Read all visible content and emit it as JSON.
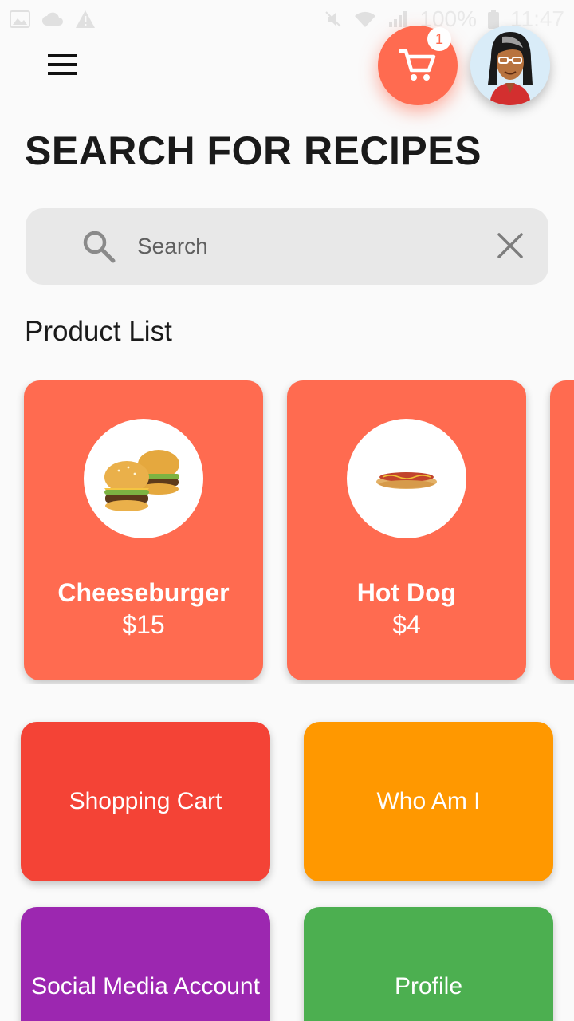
{
  "status_bar": {
    "battery": "100%",
    "time": "11:47"
  },
  "header": {
    "cart_count": "1"
  },
  "page_title": "SEARCH FOR RECIPES",
  "search": {
    "placeholder": "Search",
    "value": ""
  },
  "section_title": "Product List",
  "products": [
    {
      "name": "Cheeseburger",
      "price": "$15"
    },
    {
      "name": "Hot Dog",
      "price": "$4"
    }
  ],
  "tiles": [
    {
      "label": "Shopping Cart",
      "color": "#f44336"
    },
    {
      "label": "Who Am I",
      "color": "#ff9800"
    },
    {
      "label": "Social Media Account",
      "color": "#9c27b0"
    },
    {
      "label": "Profile",
      "color": "#4caf50"
    }
  ],
  "colors": {
    "accent": "#ff6b50",
    "background": "#fafafa"
  }
}
